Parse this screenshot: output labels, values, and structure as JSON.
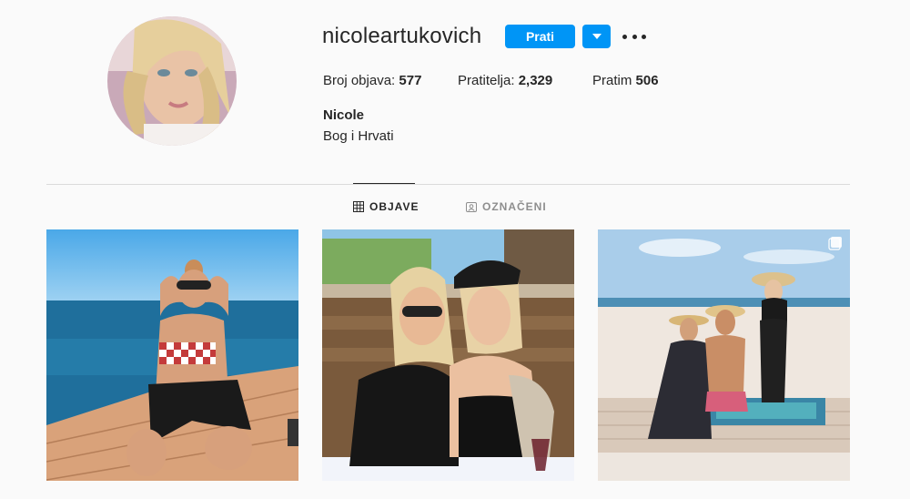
{
  "profile": {
    "username": "nicoleartukovich",
    "follow_label": "Prati",
    "stats": {
      "posts_label": "Broj objava:",
      "posts_value": "577",
      "followers_label": "Pratitelja:",
      "followers_value": "2,329",
      "following_label": "Pratim",
      "following_value": "506"
    },
    "full_name": "Nicole",
    "bio": "Bog i Hrvati"
  },
  "tabs": [
    {
      "label": "OBJAVE",
      "icon": "grid-icon",
      "active": true
    },
    {
      "label": "OZNAČENI",
      "icon": "tag-icon",
      "active": false
    }
  ],
  "posts": [
    {
      "scene": "boat-sea"
    },
    {
      "scene": "restaurant-selfie"
    },
    {
      "scene": "beach-group",
      "multi": true
    }
  ],
  "colors": {
    "accent": "#0095f6",
    "text": "#262626",
    "muted": "#8e8e8e",
    "border": "#dbdbdb",
    "background": "#fafafa"
  }
}
